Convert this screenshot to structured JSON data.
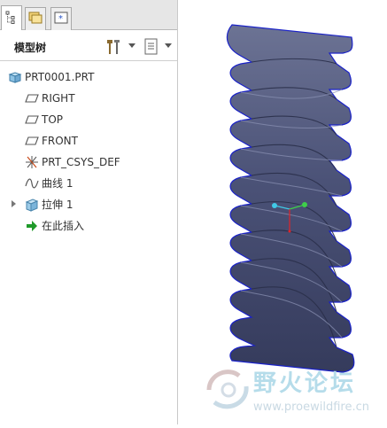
{
  "model_tree": {
    "title": "模型树",
    "root": "PRT0001.PRT",
    "items": [
      {
        "label": "RIGHT",
        "icon": "datum-plane-icon"
      },
      {
        "label": "TOP",
        "icon": "datum-plane-icon"
      },
      {
        "label": "FRONT",
        "icon": "datum-plane-icon"
      },
      {
        "label": "PRT_CSYS_DEF",
        "icon": "coordinate-system-icon"
      },
      {
        "label": "曲线 1",
        "icon": "curve-icon"
      },
      {
        "label": "拉伸 1",
        "icon": "extrude-icon"
      },
      {
        "label": "在此插入",
        "icon": "insert-here-arrow-icon"
      }
    ]
  },
  "tabs": [
    "model-tree-tab",
    "layers-tab",
    "favorites-tab"
  ],
  "watermark": {
    "title": "野火论坛",
    "url": "www.proewildfire.cn"
  },
  "colors": {
    "part_body": "#4a5174",
    "part_edge": "#1a22c8",
    "insert_arrow": "#1f9a2a"
  }
}
